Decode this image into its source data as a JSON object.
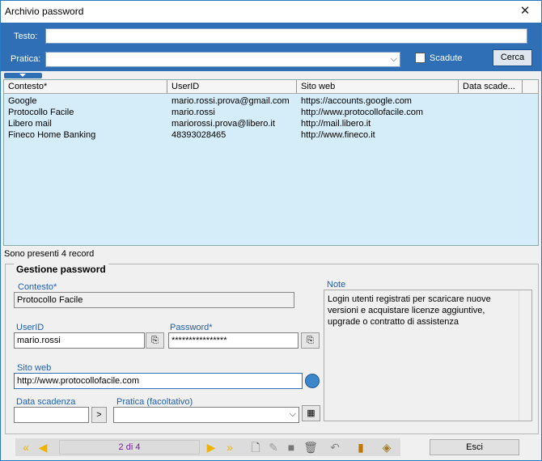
{
  "window": {
    "title": "Archivio password",
    "close_glyph": "✕"
  },
  "search": {
    "testo_label": "Testo:",
    "testo_value": "",
    "pratica_label": "Pratica:",
    "pratica_value": "",
    "scadute_label": "Scadute",
    "scadute_checked": false,
    "cerca_label": "Cerca"
  },
  "grid": {
    "columns": [
      "Contesto*",
      "UserID",
      "Sito web",
      "Data scade..."
    ],
    "rows": [
      [
        "Google",
        "mario.rossi.prova@gmail.com",
        "https://accounts.google.com",
        ""
      ],
      [
        "Protocollo Facile",
        "mario.rossi",
        "http://www.protocollofacile.com",
        ""
      ],
      [
        "Libero mail",
        "mariorossi.prova@libero.it",
        "http://mail.libero.it",
        ""
      ],
      [
        "Fineco Home Banking",
        "48393028465",
        "http://www.fineco.it",
        ""
      ]
    ],
    "status": "Sono presenti 4 record"
  },
  "form": {
    "legend": "Gestione password",
    "contesto_label": "Contesto*",
    "contesto_value": "Protocollo Facile",
    "userid_label": "UserID",
    "userid_value": "mario.rossi",
    "password_label": "Password*",
    "password_value": "****************",
    "sito_label": "Sito web",
    "sito_value": "http://www.protocollofacile.com",
    "data_label": "Data scadenza",
    "data_value": "",
    "data_btn": ">",
    "pratica_label": "Pratica (facoltativo)",
    "pratica_value": "",
    "note_label": "Note",
    "note_value": "Login utenti registrati per scaricare nuove versioni e acquistare licenze aggiuntive, upgrade o contratto di assistenza"
  },
  "nav": {
    "page_label": "2 di 4",
    "esci_label": "Esci",
    "colors": {
      "arrow": "#f0b400",
      "accent": "#2f6fb6"
    }
  }
}
